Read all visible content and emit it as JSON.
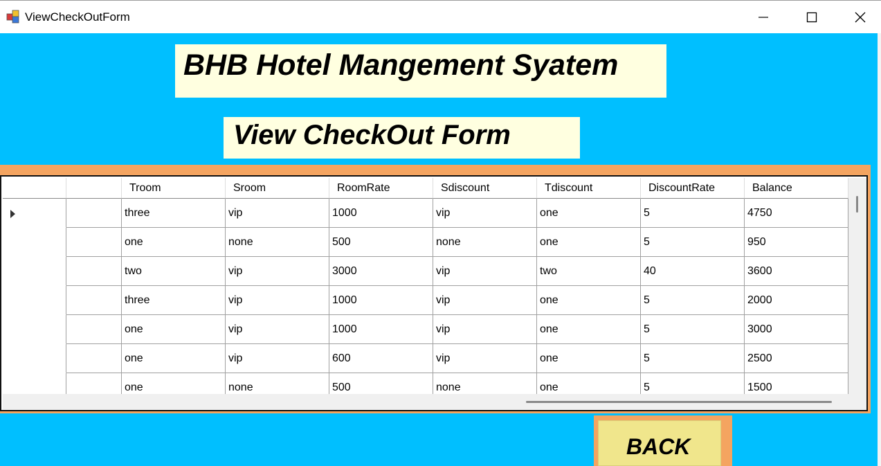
{
  "window": {
    "title": "ViewCheckOutForm"
  },
  "banners": {
    "main_title": "BHB Hotel Mangement Syatem",
    "sub_title": "View CheckOut Form"
  },
  "grid": {
    "columns": [
      "",
      "Troom",
      "Sroom",
      "RoomRate",
      "Sdiscount",
      "Tdiscount",
      "DiscountRate",
      "Balance"
    ],
    "rows": [
      [
        "",
        "three",
        "vip",
        "1000",
        "vip",
        "one",
        "5",
        "4750"
      ],
      [
        "",
        "one",
        "none",
        "500",
        "none",
        "one",
        "5",
        "950"
      ],
      [
        "",
        "two",
        "vip",
        "3000",
        "vip",
        "two",
        "40",
        "3600"
      ],
      [
        "",
        "three",
        "vip",
        "1000",
        "vip",
        "one",
        "5",
        "2000"
      ],
      [
        "",
        "one",
        "vip",
        "1000",
        "vip",
        "one",
        "5",
        "3000"
      ],
      [
        "",
        "one",
        "vip",
        "600",
        "vip",
        "one",
        "5",
        "2500"
      ],
      [
        "",
        "one",
        "none",
        "500",
        "none",
        "one",
        "5",
        "1500"
      ]
    ],
    "selected_row": 0
  },
  "buttons": {
    "back_label": "BACK"
  },
  "colors": {
    "background": "#00BFFF",
    "banner": "#FFFFE0",
    "frame": "#F4A460",
    "back_button": "#F0E68C"
  }
}
